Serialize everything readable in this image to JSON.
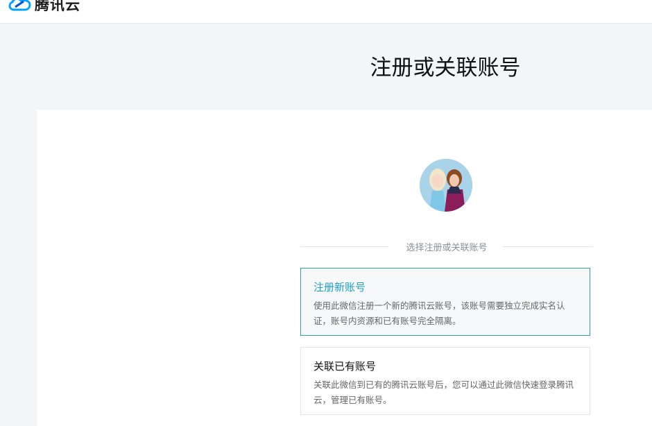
{
  "header": {
    "logo_text": "腾讯云"
  },
  "page": {
    "title": "注册或关联账号"
  },
  "divider_text": "选择注册或关联账号",
  "options": [
    {
      "title": "注册新账号",
      "description": "使用此微信注册一个新的腾讯云账号，该账号需要独立完成实名认证，账号内资源和已有账号完全隔离。",
      "selected": true
    },
    {
      "title": "关联已有账号",
      "description": "关联此微信到已有的腾讯云账号后，您可以通过此微信快速登录腾讯云，管理已有账号。",
      "selected": false
    }
  ],
  "colors": {
    "accent": "#1f9fc4",
    "selected_border": "#2f9fa3",
    "page_bg": "#f4f5f7"
  }
}
